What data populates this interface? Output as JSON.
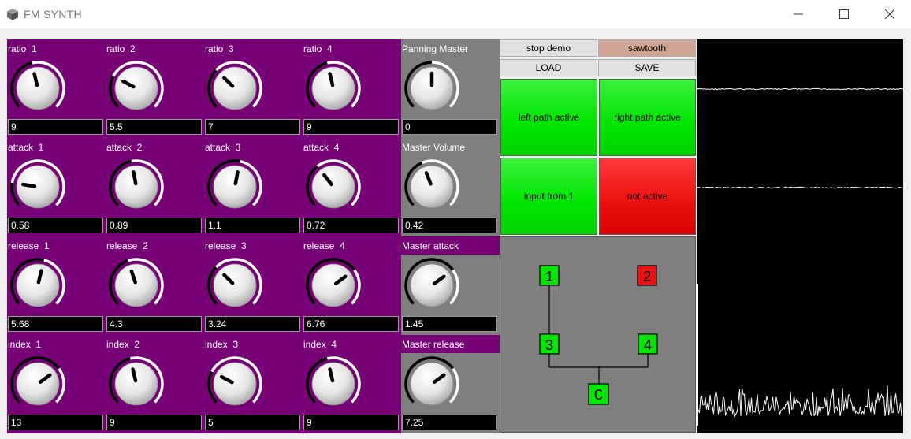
{
  "window": {
    "title": "FM SYNTH",
    "app_icon": "box-icon",
    "controls": [
      "minimize-icon",
      "maximize-icon",
      "close-icon"
    ]
  },
  "colors": {
    "operator_panel": "#770077",
    "master_panel": "#7f7f7f",
    "active": "#00e600",
    "inactive": "#ee1111",
    "knob_arc": "#ffffff",
    "knob_arc_off": "#000000"
  },
  "operators": [
    {
      "label": "ratio  1",
      "value": "9",
      "level": 0.45
    },
    {
      "label": "ratio  2",
      "value": "5.5",
      "level": 0.27
    },
    {
      "label": "ratio  3",
      "value": "7",
      "level": 0.33
    },
    {
      "label": "ratio  4",
      "value": "9",
      "level": 0.45
    },
    {
      "label": "attack  1",
      "value": "0.58",
      "level": 0.2
    },
    {
      "label": "attack  2",
      "value": "0.89",
      "level": 0.46
    },
    {
      "label": "attack  3",
      "value": "1.1",
      "level": 0.54
    },
    {
      "label": "attack  4",
      "value": "0.72",
      "level": 0.36
    },
    {
      "label": "release  1",
      "value": "5.68",
      "level": 0.55
    },
    {
      "label": "release  2",
      "value": "4.3",
      "level": 0.43
    },
    {
      "label": "release  3",
      "value": "3.24",
      "level": 0.33
    },
    {
      "label": "release  4",
      "value": "6.76",
      "level": 0.7
    },
    {
      "label": "index  1",
      "value": "13",
      "level": 0.7
    },
    {
      "label": "index  2",
      "value": "9",
      "level": 0.45
    },
    {
      "label": "index  3",
      "value": "5",
      "level": 0.27
    },
    {
      "label": "index  4",
      "value": "9",
      "level": 0.45
    }
  ],
  "master": [
    {
      "label": "Panning Master",
      "value": "0",
      "level": 0.5
    },
    {
      "label": "Master Volume",
      "value": "0.42",
      "level": 0.42
    },
    {
      "label": "Master attack",
      "value": "1.45",
      "level": 0.7
    },
    {
      "label": "Master release",
      "value": "7.25",
      "level": 0.7
    }
  ],
  "buttons": {
    "stop_demo": "stop demo",
    "waveform": "sawtooth",
    "load": "LOAD",
    "save": "SAVE"
  },
  "paths": {
    "left": {
      "label": "left path active",
      "state": "active"
    },
    "right": {
      "label": "right path active",
      "state": "active"
    },
    "input": {
      "label": "input from 1",
      "state": "active"
    },
    "other": {
      "label": "not active",
      "state": "inactive"
    }
  },
  "routing": {
    "nodes": [
      {
        "id": "1",
        "state": "active"
      },
      {
        "id": "2",
        "state": "inactive"
      },
      {
        "id": "3",
        "state": "active"
      },
      {
        "id": "4",
        "state": "active"
      },
      {
        "id": "C",
        "state": "active"
      }
    ]
  }
}
